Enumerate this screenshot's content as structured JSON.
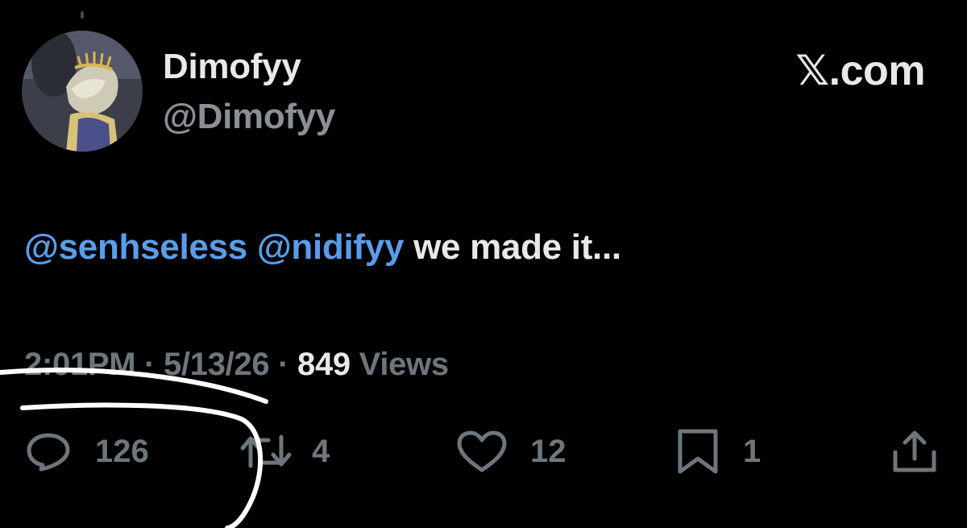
{
  "post": {
    "author": {
      "display_name": "Dimofyy",
      "handle": "@Dimofyy",
      "avatar_icon": "avatar-illustration"
    },
    "brand": "𝕏.com",
    "text": {
      "mention_1": "@senhseless",
      "mention_2": "@nidifyy",
      "body": "we made it..."
    },
    "meta": {
      "time": "2:01PM",
      "separator": "·",
      "date": "5/13/26",
      "views_count": "849",
      "views_label": "Views"
    },
    "actions": {
      "reply": {
        "icon": "reply-icon",
        "count": "126"
      },
      "repost": {
        "icon": "repost-icon",
        "count": "4"
      },
      "like": {
        "icon": "heart-icon",
        "count": "12"
      },
      "bookmark": {
        "icon": "bookmark-icon",
        "count": "1"
      },
      "share": {
        "icon": "share-icon"
      }
    }
  },
  "colors": {
    "background": "#000000",
    "text_primary": "#e7e9ea",
    "text_secondary": "#6e767d",
    "mention": "#5a9ce9",
    "annotation": "#ffffff"
  }
}
